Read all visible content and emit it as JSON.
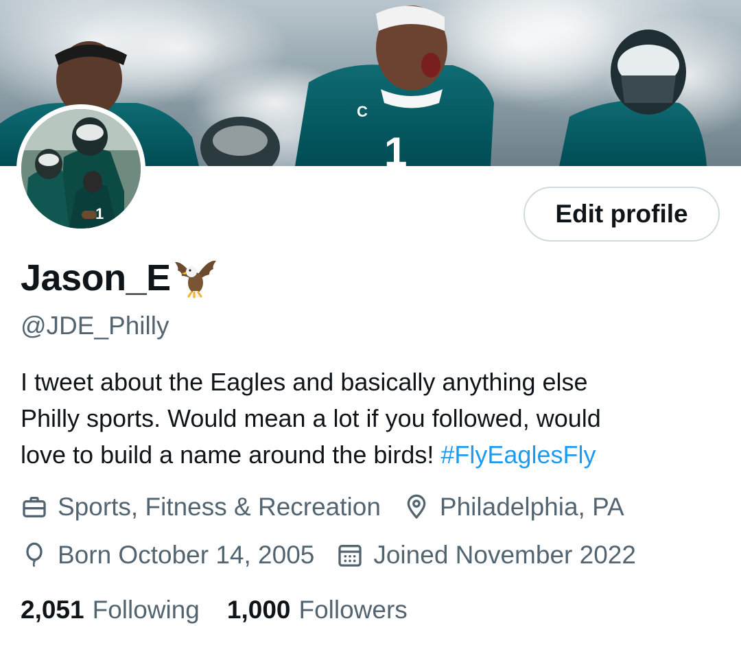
{
  "header": {
    "banner_icon": "eagles-players-banner-photo"
  },
  "profile": {
    "avatar_icon": "eagles-players-avatar-photo",
    "edit_button_label": "Edit profile",
    "display_name": "Jason_E",
    "display_name_emoji_icon": "eagle-emoji-icon",
    "handle": "@JDE_Philly",
    "bio_lines": [
      "I tweet about the Eagles and basically anything else",
      "Philly sports. Would mean a lot if you followed, would",
      "love to build a name around the birds! "
    ],
    "bio_hashtag": "#FlyEaglesFly",
    "category": "Sports, Fitness & Recreation",
    "location": "Philadelphia, PA",
    "birthday": "Born October 14, 2005",
    "joined": "Joined November 2022",
    "following_count": "2,051",
    "following_label": "Following",
    "followers_count": "1,000",
    "followers_label": "Followers"
  },
  "colors": {
    "link": "#1d9bf0",
    "secondary_text": "#536471",
    "primary_text": "#0f1419",
    "button_border": "#cfd9de",
    "eagles_green": "#004c54"
  }
}
